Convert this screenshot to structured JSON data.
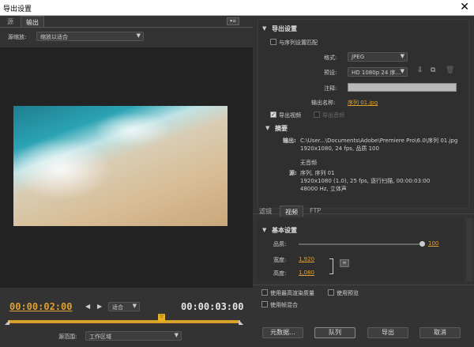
{
  "window": {
    "title": "导出设置"
  },
  "left": {
    "tabs": [
      {
        "label": "源"
      },
      {
        "label": "输出"
      }
    ],
    "source_scale_label": "源缩放:",
    "source_scale_value": "缩放以适合",
    "timecode_current": "00:00:02:00",
    "timecode_end": "00:00:03:00",
    "fit_value": "适合",
    "source_range_label": "源范围:",
    "source_range_value": "工作区域",
    "progress": 0.66
  },
  "export_settings": {
    "header": "导出设置",
    "match_sequence_label": "与序列设置匹配",
    "format_label": "格式:",
    "format_value": "JPEG",
    "preset_label": "预设:",
    "preset_value": "HD 1080p 24 序...",
    "comments_label": "注释:",
    "comments_value": "",
    "output_name_label": "输出名称:",
    "output_name_value": "序列 01.jpg",
    "export_video_label": "导出视频",
    "export_audio_label": "导出音频",
    "summary_header": "摘要",
    "output_key": "输出:",
    "output_line1": "C:\\User...\\Documents\\Adobe\\Premiere Pro\\6.0\\序列 01.jpg",
    "output_line2": "1920x1080, 24 fps, 品质 100",
    "no_audio": "无音频",
    "source_key": "源:",
    "source_line1": "序列, 序列 01",
    "source_line2": "1920x1080 (1.0), 25 fps, 逐行扫描, 00:00:03:00",
    "source_line3": "48000 Hz, 立体声"
  },
  "bottom_tabs": [
    {
      "label": "滤镜"
    },
    {
      "label": "视频"
    },
    {
      "label": "FTP"
    }
  ],
  "basic": {
    "header": "基本设置",
    "quality_label": "品质:",
    "quality_value": "100",
    "quality_level": 1.0,
    "width_label": "宽度:",
    "width_value": "1,920",
    "height_label": "高度:",
    "height_value": "1,080"
  },
  "options": {
    "max_render_label": "使用最高渲染质量",
    "use_preview_label": "使用预览",
    "frame_blend_label": "使用帧混合"
  },
  "buttons": {
    "metadata": "元数据...",
    "queue": "队列",
    "export": "导出",
    "cancel": "取消"
  }
}
